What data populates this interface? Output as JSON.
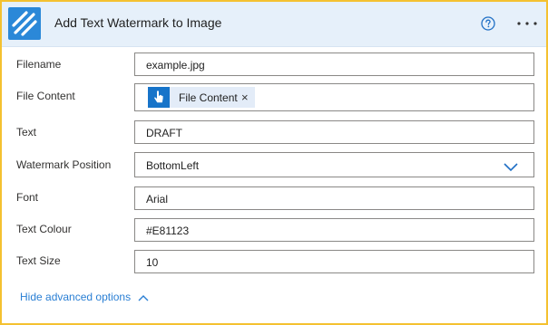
{
  "header": {
    "title": "Add Text Watermark to Image",
    "logo_icon": "diagonal-stripes-logo-icon",
    "help_icon": "question-circle-icon",
    "more_icon": "ellipsis-icon"
  },
  "fields": [
    {
      "label": "Filename",
      "value": "example.jpg"
    },
    {
      "label": "File Content",
      "token_label": "File Content",
      "token_icon": "pointer-hand-icon",
      "token_close": "×"
    },
    {
      "label": "Text",
      "value": "DRAFT"
    },
    {
      "label": "Watermark Position",
      "value": "BottomLeft"
    },
    {
      "label": "Font",
      "value": "Arial"
    },
    {
      "label": "Text Colour",
      "value": "#E81123"
    },
    {
      "label": "Text Size",
      "value": "10"
    }
  ],
  "footer": {
    "advanced_link": "Hide advanced options"
  },
  "colors": {
    "border": "#f4c130",
    "header_bg": "#e6f0fa",
    "accent": "#2b88d8",
    "link": "#2a7fd4"
  }
}
